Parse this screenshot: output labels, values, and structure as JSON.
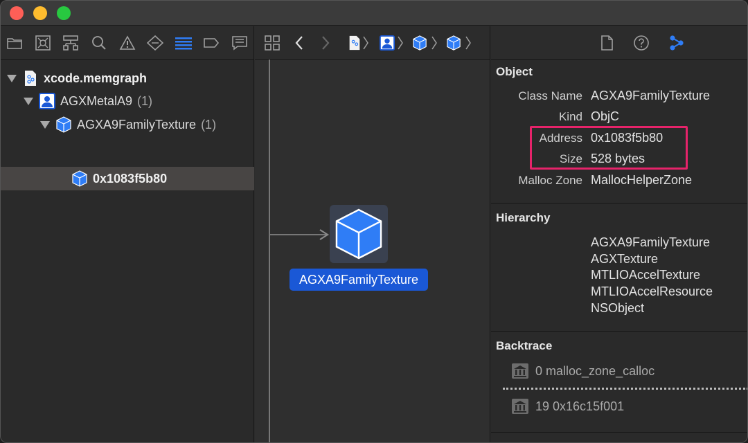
{
  "navigator": {
    "root": "xcode.memgraph",
    "items": [
      {
        "label": "AGXMetalA9",
        "count": "(1)"
      },
      {
        "label": "AGXA9FamilyTexture",
        "count": "(1)"
      },
      {
        "label": "0x1083f5b80"
      }
    ]
  },
  "graph": {
    "node_label": "AGXA9FamilyTexture"
  },
  "inspector": {
    "object_title": "Object",
    "fields": [
      {
        "label": "Class Name",
        "value": "AGXA9FamilyTexture"
      },
      {
        "label": "Kind",
        "value": "ObjC"
      },
      {
        "label": "Address",
        "value": "0x1083f5b80"
      },
      {
        "label": "Size",
        "value": "528 bytes"
      },
      {
        "label": "Malloc Zone",
        "value": "MallocHelperZone"
      }
    ],
    "hierarchy_title": "Hierarchy",
    "hierarchy": [
      "AGXA9FamilyTexture",
      "AGXTexture",
      "MTLIOAccelTexture",
      "MTLIOAccelResource",
      "NSObject"
    ],
    "backtrace_title": "Backtrace",
    "backtrace": [
      "0 malloc_zone_calloc",
      "19 0x16c15f001"
    ]
  },
  "colors": {
    "accent": "#1a58d6",
    "highlight": "#e6236a",
    "cube": "#2f7df6"
  },
  "icons": {
    "navigator_toolbar": [
      "folder-icon",
      "source-control-icon",
      "hierarchy-icon",
      "search-icon",
      "warning-icon",
      "test-icon",
      "debug-icon",
      "breakpoint-icon",
      "report-icon"
    ],
    "inspector_toolbar": [
      "file-inspector-icon",
      "help-icon",
      "memory-inspector-icon"
    ]
  }
}
